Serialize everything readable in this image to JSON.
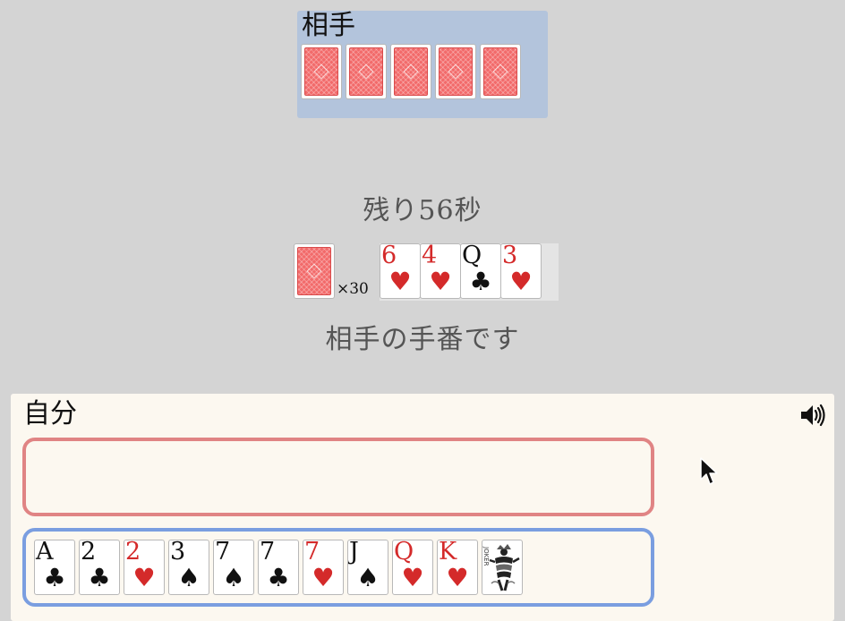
{
  "opponent": {
    "title": "相手",
    "card_count": 5
  },
  "timer_text": "残り56秒",
  "deck": {
    "count_label": "×30"
  },
  "table_cards": [
    {
      "rank": "6",
      "suit": "♥",
      "color": "red"
    },
    {
      "rank": "4",
      "suit": "♥",
      "color": "red"
    },
    {
      "rank": "Q",
      "suit": "♣",
      "color": "black"
    },
    {
      "rank": "3",
      "suit": "♥",
      "color": "red"
    }
  ],
  "turn_message": "相手の手番です",
  "player": {
    "title": "自分",
    "sound_icon": "speaker-volume-icon",
    "hand": [
      {
        "rank": "A",
        "suit": "♣",
        "color": "black"
      },
      {
        "rank": "2",
        "suit": "♣",
        "color": "black"
      },
      {
        "rank": "2",
        "suit": "♥",
        "color": "red"
      },
      {
        "rank": "3",
        "suit": "♠",
        "color": "black"
      },
      {
        "rank": "7",
        "suit": "♠",
        "color": "black"
      },
      {
        "rank": "7",
        "suit": "♣",
        "color": "black"
      },
      {
        "rank": "7",
        "suit": "♥",
        "color": "red"
      },
      {
        "rank": "J",
        "suit": "♠",
        "color": "black"
      },
      {
        "rank": "Q",
        "suit": "♥",
        "color": "red"
      },
      {
        "rank": "K",
        "suit": "♥",
        "color": "red"
      }
    ],
    "joker": {
      "icon": "joker-icon"
    }
  },
  "colors": {
    "background": "#d4d4d4",
    "opponent_panel": "#b3c4dc",
    "player_panel": "#fcf8f0",
    "play_zone_border": "#e08484",
    "hand_zone_border": "#7a9ee0",
    "red_suit": "#d42a2a",
    "card_back": "#f26a6a"
  }
}
